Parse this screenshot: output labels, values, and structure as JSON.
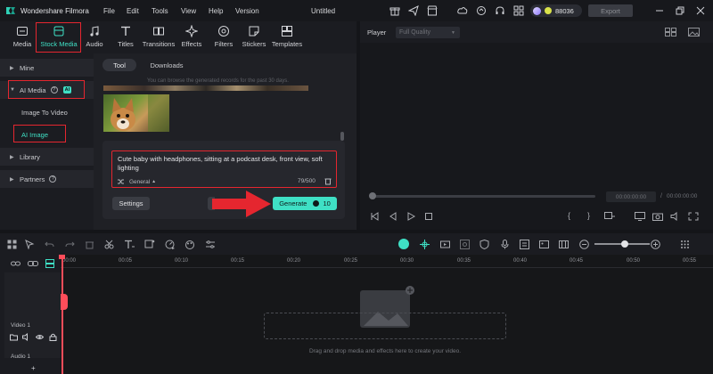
{
  "titlebar": {
    "app_name": "Wondershare Filmora",
    "menus": [
      "File",
      "Edit",
      "Tools",
      "View",
      "Help",
      "Version"
    ],
    "project_title": "Untitled",
    "credits": "88036",
    "export_label": "Export"
  },
  "toolbar": {
    "tools": [
      "Media",
      "Stock Media",
      "Audio",
      "Titles",
      "Transitions",
      "Effects",
      "Filters",
      "Stickers",
      "Templates"
    ]
  },
  "sidebar": {
    "mine": "Mine",
    "ai_media": "AI Media",
    "ai_badge": "AI",
    "image_to_video": "Image To Video",
    "ai_image": "AI Image",
    "library": "Library",
    "partners": "Partners"
  },
  "content": {
    "tab_tool": "Tool",
    "tab_downloads": "Downloads",
    "hint": "You can browse the generated records for the past 30 days.",
    "prompt": "Cute baby with headphones, sitting at a podcast desk, front view, soft lighting",
    "style": "General",
    "char_count": "79/500",
    "settings_label": "Settings",
    "generate_label": "Generate",
    "generate_cost": "10"
  },
  "player": {
    "label": "Player",
    "quality": "Full Quality",
    "time_current": "00:00:00:00",
    "time_sep": "/",
    "time_total": "00:00:00:00"
  },
  "timeline": {
    "ticks": [
      "00:00",
      "00:05",
      "00:10",
      "00:15",
      "00:20",
      "00:25",
      "00:30",
      "00:35",
      "00:40",
      "00:45",
      "00:50",
      "00:55"
    ],
    "video_track": "Video 1",
    "audio_track": "Audio 1",
    "drop_text": "Drag and drop media and effects here to create your video."
  },
  "colors": {
    "accent": "#3fe0c5",
    "highlight": "#e5262f",
    "playhead": "#ff4d5a"
  }
}
